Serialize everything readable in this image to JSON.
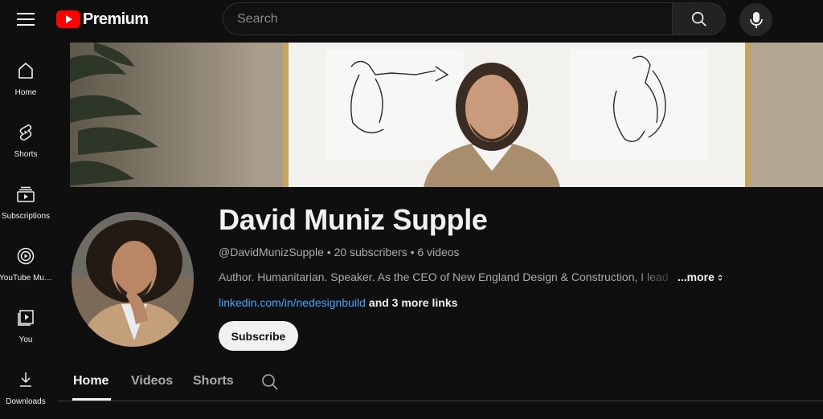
{
  "header": {
    "logo_text": "Premium",
    "search_placeholder": "Search"
  },
  "sidebar": {
    "items": [
      {
        "label": "Home",
        "icon": "home-icon"
      },
      {
        "label": "Shorts",
        "icon": "shorts-icon"
      },
      {
        "label": "Subscriptions",
        "icon": "subscriptions-icon"
      },
      {
        "label": "YouTube Mu…",
        "icon": "youtube-music-icon"
      },
      {
        "label": "You",
        "icon": "you-icon"
      },
      {
        "label": "Downloads",
        "icon": "download-icon"
      }
    ]
  },
  "channel": {
    "name": "David Muniz Supple",
    "handle": "@DavidMunizSupple",
    "subscribers": "20 subscribers",
    "videos": "6 videos",
    "separator": " • ",
    "description": "Author. Humanitarian. Speaker. As the CEO of New England Design & Construction, I lead",
    "more_label": "...more",
    "link": "linkedin.com/in/nedesignbuild",
    "more_links": "and 3 more links",
    "subscribe_label": "Subscribe"
  },
  "tabs": [
    {
      "label": "Home",
      "active": true
    },
    {
      "label": "Videos",
      "active": false
    },
    {
      "label": "Shorts",
      "active": false
    }
  ],
  "colors": {
    "background": "#0f0f0f",
    "brand_red": "#ff0000",
    "link_blue": "#3ea6ff"
  }
}
